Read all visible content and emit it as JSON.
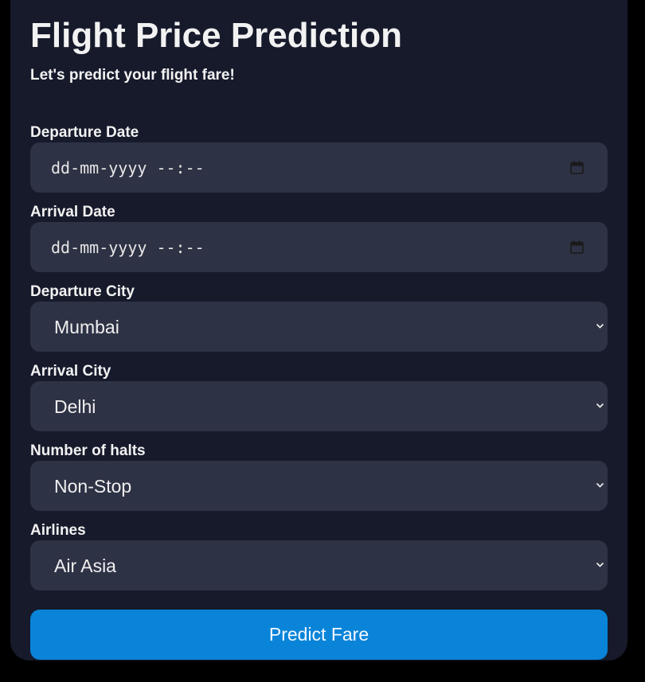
{
  "header": {
    "title": "Flight Price Prediction",
    "subtitle": "Let's predict your flight fare!"
  },
  "form": {
    "departure_date": {
      "label": "Departure Date",
      "placeholder": "dd-mm-yyyy --:--",
      "icon": "calendar-icon"
    },
    "arrival_date": {
      "label": "Arrival Date",
      "placeholder": "dd-mm-yyyy --:--",
      "icon": "calendar-icon"
    },
    "departure_city": {
      "label": "Departure City",
      "selected": "Mumbai",
      "icon": "chevron-down-icon"
    },
    "arrival_city": {
      "label": "Arrival City",
      "selected": "Delhi",
      "icon": "chevron-down-icon"
    },
    "halts": {
      "label": "Number of halts",
      "selected": "Non-Stop",
      "icon": "chevron-down-icon"
    },
    "airlines": {
      "label": "Airlines",
      "selected": "Air Asia",
      "icon": "chevron-down-icon"
    },
    "submit_label": "Predict Fare"
  },
  "colors": {
    "page_background": "#000000",
    "card_background": "#161a2b",
    "field_background": "#2e3245",
    "button_background": "#0984d9",
    "text": "#f2f2f2"
  }
}
